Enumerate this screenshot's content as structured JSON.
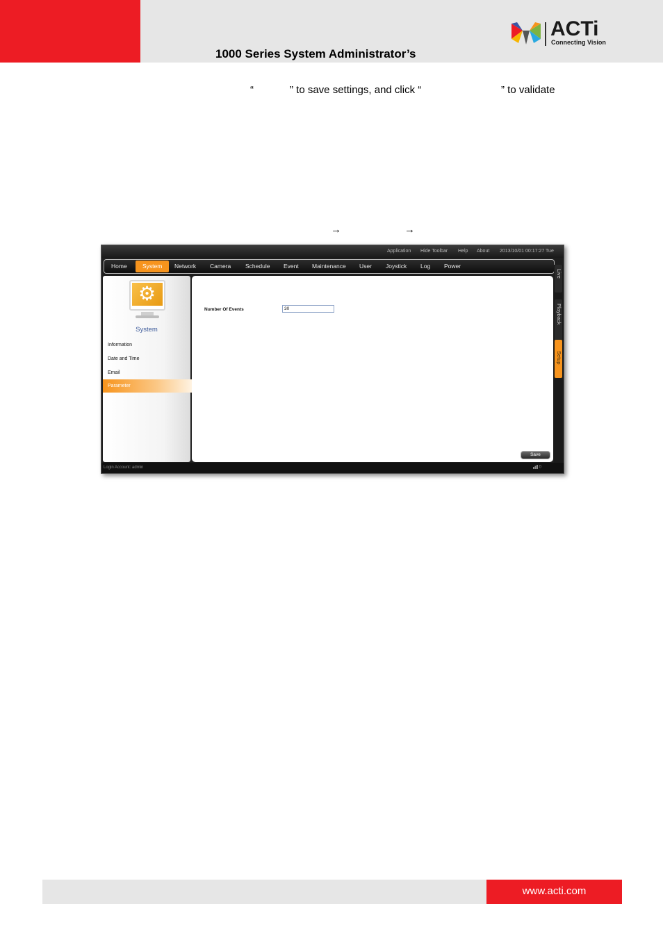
{
  "header": {
    "title": "1000 Series System Administrator’s",
    "logo_word": "ACTi",
    "logo_tagline": "Connecting Vision",
    "colors": {
      "red": "#ed1c24",
      "grey": "#e6e6e6"
    }
  },
  "body_text": {
    "line1_open_quote": "“",
    "line1_mid": "” to save settings, and click “",
    "line1_end": "” to validate",
    "arrow1": "→",
    "arrow2": "→"
  },
  "screenshot": {
    "topbar": [
      "Application",
      "Hide Toolbar",
      "Help",
      "About",
      "2013/10/01 00:17:27 Tue"
    ],
    "menu": [
      "Home",
      "System",
      "Network",
      "Camera",
      "Schedule",
      "Event",
      "Maintenance",
      "User",
      "Joystick",
      "Log",
      "Power"
    ],
    "active_menu": "System",
    "sidebar": {
      "title": "System",
      "icon": "gear-icon",
      "items": [
        "Information",
        "Date and Time",
        "Email",
        "Parameter"
      ],
      "active_item": "Parameter"
    },
    "content": {
      "field_label": "Number Of Events",
      "field_value": "30",
      "save_label": "Save"
    },
    "side_tabs": [
      "Live",
      "Playback",
      "Setup"
    ],
    "active_side_tab": "Setup",
    "status_left": "Login Account: admin",
    "status_right": "0",
    "accent_color": "#f7941d"
  },
  "footer": {
    "url": "www.acti.com"
  }
}
